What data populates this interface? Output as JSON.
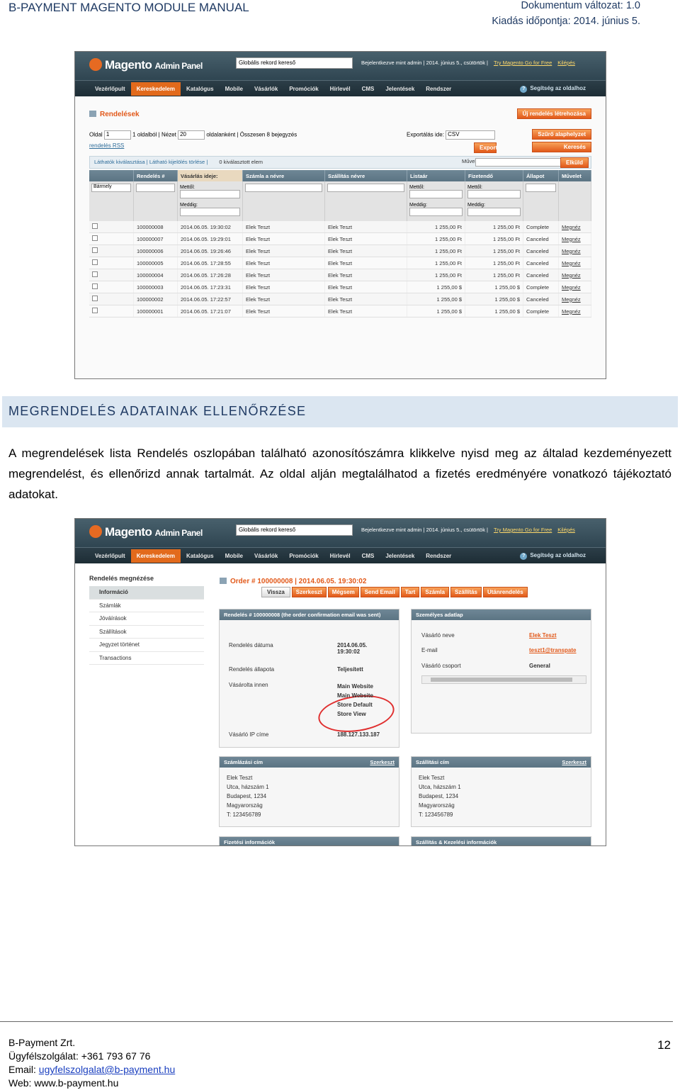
{
  "header": {
    "title": "B-PAYMENT MAGENTO MODULE MANUAL",
    "version": "Dokumentum változat: 1.0",
    "date": "Kiadás időpontja: 2014. június 5."
  },
  "magento": {
    "logo": "Magento",
    "logo_sub": "Admin Panel",
    "search_placeholder": "Globális rekord kereső",
    "user_info": "Bejelentkezve mint admin  |  2014. június 5., csütörtök  |",
    "try_link": "Try Magento Go for Free",
    "logout_link": "Kilépés",
    "nav": [
      "Vezérlőpult",
      "Kereskedelem",
      "Katalógus",
      "Mobile",
      "Vásárlók",
      "Promóciók",
      "Hírlevél",
      "CMS",
      "Jelentések",
      "Rendszer"
    ],
    "nav_active": "Kereskedelem",
    "help": "Segítség az oldalhoz"
  },
  "orders_screen": {
    "title": "Rendelések",
    "new_order_button": "Új rendelés létrehozása",
    "pager": {
      "page_label": "Oldal",
      "page_value": "1",
      "of_pages": "1 oldalból",
      "view_label": "Nézet",
      "view_value": "20",
      "per_page": "oldalanként",
      "total": "Összesen 8 bejegyzés",
      "rss": "rendelés RSS"
    },
    "export_label": "Exportálás ide:",
    "export_format": "CSV",
    "export_button": "Export",
    "reset_filter_button": "Szűrő alaphelyzet",
    "search_button": "Keresés",
    "mass": {
      "select_visible": "Láthatók kiválasztása",
      "unselect_visible": "Látható kijelölés törlése",
      "selected_count": "0 kiválasztott elem",
      "actions_label": "Műveletek",
      "submit": "Elküld"
    },
    "columns": [
      "",
      "Rendelés #",
      "Vásárlás ideje:",
      "Számla a névre",
      "Szállítás névre",
      "Listaár",
      "Fizetendő",
      "Állapot",
      "Művelet"
    ],
    "filter": {
      "any": "Bármely",
      "from": "Mettől:",
      "to": "Meddig:"
    },
    "rows": [
      {
        "id": "100000008",
        "date": "2014.06.05. 19:30:02",
        "bill": "Elek Teszt",
        "ship": "Elek Teszt",
        "base": "1 255,00 Ft",
        "paid": "1 255,00 Ft",
        "status": "Complete",
        "action": "Megnéz"
      },
      {
        "id": "100000007",
        "date": "2014.06.05. 19:29:01",
        "bill": "Elek Teszt",
        "ship": "Elek Teszt",
        "base": "1 255,00 Ft",
        "paid": "1 255,00 Ft",
        "status": "Canceled",
        "action": "Megnéz"
      },
      {
        "id": "100000006",
        "date": "2014.06.05. 19:26:46",
        "bill": "Elek Teszt",
        "ship": "Elek Teszt",
        "base": "1 255,00 Ft",
        "paid": "1 255,00 Ft",
        "status": "Canceled",
        "action": "Megnéz"
      },
      {
        "id": "100000005",
        "date": "2014.06.05. 17:28:55",
        "bill": "Elek Teszt",
        "ship": "Elek Teszt",
        "base": "1 255,00 Ft",
        "paid": "1 255,00 Ft",
        "status": "Canceled",
        "action": "Megnéz"
      },
      {
        "id": "100000004",
        "date": "2014.06.05. 17:26:28",
        "bill": "Elek Teszt",
        "ship": "Elek Teszt",
        "base": "1 255,00 Ft",
        "paid": "1 255,00 Ft",
        "status": "Canceled",
        "action": "Megnéz"
      },
      {
        "id": "100000003",
        "date": "2014.06.05. 17:23:31",
        "bill": "Elek Teszt",
        "ship": "Elek Teszt",
        "base": "1 255,00 $",
        "paid": "1 255,00 $",
        "status": "Complete",
        "action": "Megnéz"
      },
      {
        "id": "100000002",
        "date": "2014.06.05. 17:22:57",
        "bill": "Elek Teszt",
        "ship": "Elek Teszt",
        "base": "1 255,00 $",
        "paid": "1 255,00 $",
        "status": "Canceled",
        "action": "Megnéz"
      },
      {
        "id": "100000001",
        "date": "2014.06.05. 17:21:07",
        "bill": "Elek Teszt",
        "ship": "Elek Teszt",
        "base": "1 255,00 $",
        "paid": "1 255,00 $",
        "status": "Complete",
        "action": "Megnéz"
      }
    ]
  },
  "section": {
    "title": "MEGRENDELÉS ADATAINAK ELLENŐRZÉSE",
    "paragraph": "A megrendelések lista Rendelés oszlopában található azonosítószámra klikkelve nyisd meg az általad kezdeményezett megrendelést, és ellenőrizd annak tartalmát. Az oldal alján megtalálhatod a fizetés eredményére vonatkozó tájékoztató adatokat."
  },
  "order_view_screen": {
    "side_title": "Rendelés megnézése",
    "tabs": [
      "Információ",
      "Számlák",
      "Jóváírások",
      "Szállítások",
      "Jegyzet történet",
      "Transactions"
    ],
    "order_title": "Order # 100000008 | 2014.06.05. 19:30:02",
    "buttons_grey": [
      "Vissza"
    ],
    "buttons": [
      "Szerkeszt",
      "Mégsem",
      "Send Email",
      "Tart",
      "Számla",
      "Szállítás",
      "Utánrendelés"
    ],
    "order_box": {
      "header": "Rendelés # 100000008 (the order confirmation email was sent)",
      "date_label": "Rendelés dátuma",
      "date_value": "2014.06.05. 19:30:02",
      "status_label": "Rendelés állapota",
      "status_value": "Teljesített",
      "purchased_label": "Vásárolta innen",
      "purchased_value": "Main Website Main Website Store Default Store View",
      "ip_label": "Vásárló IP címe",
      "ip_value": "188.127.133.187"
    },
    "account_box": {
      "header": "Személyes adatlap",
      "name_label": "Vásárló neve",
      "name_value": "Elek Teszt",
      "email_label": "E-mail",
      "email_value": "teszt1@transpate",
      "group_label": "Vásárló csoport",
      "group_value": "General"
    },
    "billing_box": {
      "header": "Számlázási cím",
      "edit": "Szerkeszt",
      "lines": [
        "Elek Teszt",
        "Utca, házszám 1",
        "Budapest, 1234",
        "Magyarország",
        "T: 123456789"
      ]
    },
    "shipping_box": {
      "header": "Szállítási cím",
      "edit": "Szerkeszt",
      "lines": [
        "Elek Teszt",
        "Utca, házszám 1",
        "Budapest, 1234",
        "Magyarország",
        "T: 123456789"
      ]
    },
    "payment_header": "Fizetési információk",
    "shipping_method_header": "Szállítás & Kezelési információk"
  },
  "footer": {
    "company": "B-Payment Zrt.",
    "phone": "Ügyfélszolgálat: +361 793 67 76",
    "email_label": "Email:",
    "email": "ugyfelszolgalat@b-payment.hu",
    "web": "Web: www.b-payment.hu",
    "page": "12"
  }
}
